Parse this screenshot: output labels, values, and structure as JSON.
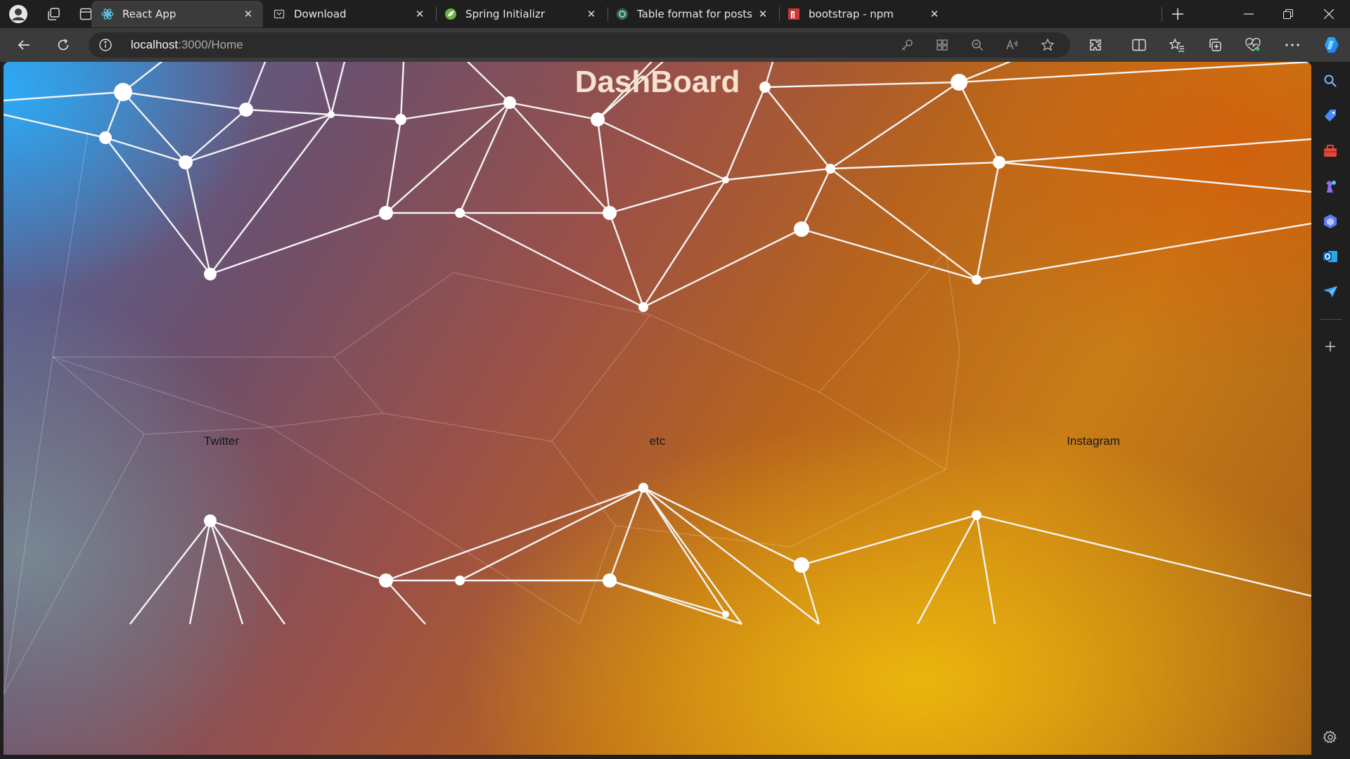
{
  "browser": {
    "tabs": [
      {
        "title": "React App",
        "icon": "react-icon",
        "active": true
      },
      {
        "title": "Download",
        "icon": "download-page-icon",
        "active": false
      },
      {
        "title": "Spring Initializr",
        "icon": "spring-leaf-icon",
        "active": false
      },
      {
        "title": "Table format for posts",
        "icon": "chatgpt-icon",
        "active": false
      },
      {
        "title": "bootstrap - npm",
        "icon": "npm-icon",
        "active": false
      }
    ],
    "address": {
      "host": "localhost",
      "path": ":3000/Home"
    }
  },
  "page": {
    "title": "DashBoard",
    "columns": [
      "Twitter",
      "etc",
      "Instagram"
    ]
  },
  "sidebar_icons": [
    "search-icon",
    "shopping-tag-icon",
    "toolbox-icon",
    "games-icon",
    "copilot-hex-icon",
    "outlook-icon",
    "send-icon",
    "add-icon",
    "settings-icon"
  ],
  "colors": {
    "chrome_dark": "#1f1f1f",
    "toolbar": "#3b3b3b",
    "title_text": "#f6e2cf"
  }
}
